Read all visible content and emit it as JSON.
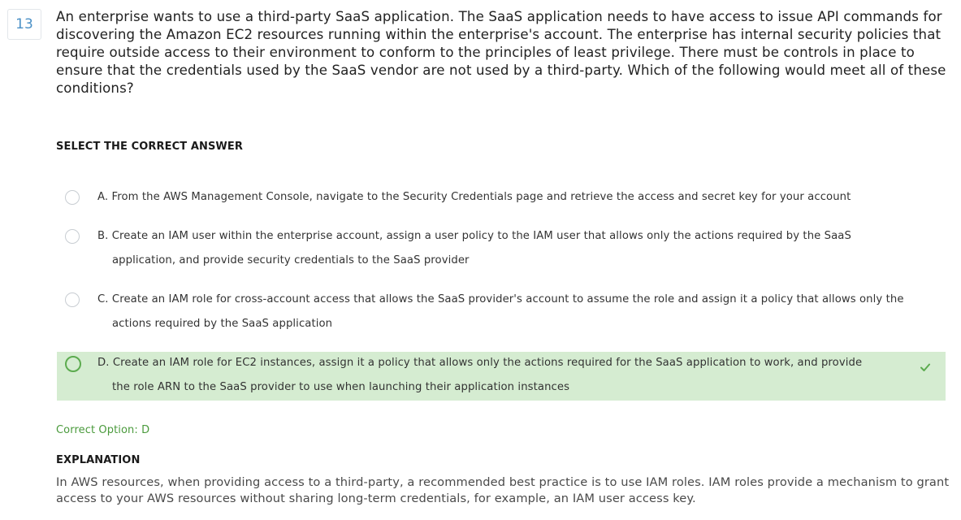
{
  "question": {
    "number": "13",
    "text": "An enterprise wants to use a third-party SaaS application. The SaaS application needs to have access to issue API commands for discovering the Amazon EC2 resources running within the enterprise's account. The enterprise has internal security policies that require outside access to their environment to conform to the principles of least privilege. There must be controls in place to ensure that the credentials used by the SaaS vendor are not used by a third-party. Which of the following would meet all of these conditions?"
  },
  "select_label": "SELECT THE CORRECT ANSWER",
  "options": [
    {
      "letter": "A.",
      "line1": "From the AWS Management Console, navigate to the Security Credentials page and retrieve the access and secret key for your account",
      "line2": ""
    },
    {
      "letter": "B.",
      "line1": "Create an IAM user within the enterprise account, assign a user policy to the IAM user that allows only the actions required by the SaaS",
      "line2": "application, and provide security credentials to the SaaS provider"
    },
    {
      "letter": "C.",
      "line1": "Create an IAM role for cross-account access that allows the SaaS provider's account to assume the role and assign it a policy that allows only the",
      "line2": "actions required by the SaaS application"
    },
    {
      "letter": "D.",
      "line1": "Create an IAM role for EC2 instances, assign it a policy that allows only the actions required for the SaaS application to work, and provide",
      "line2": "the role ARN to the SaaS provider to use when launching their application instances"
    }
  ],
  "correct_option_text": "Correct Option: D",
  "explanation": {
    "heading": "EXPLANATION",
    "text": "In AWS resources, when providing access to a third-party, a recommended best practice is to use IAM roles. IAM roles provide a mechanism to grant access to your AWS resources without sharing long-term credentials, for example, an IAM user access key."
  },
  "colors": {
    "correct_bg": "#d5ecd1",
    "correct_accent": "#5cab4f",
    "question_number": "#4a90c6"
  },
  "icons": {
    "check": "check-icon",
    "radio": "radio-icon"
  }
}
